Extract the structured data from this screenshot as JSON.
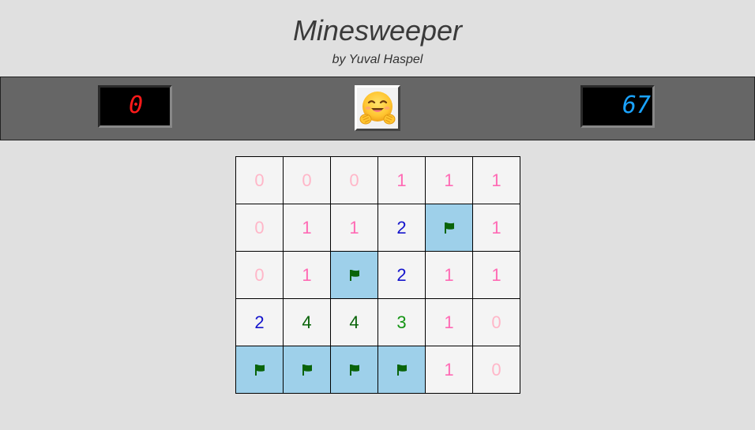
{
  "header": {
    "title": "Minesweeper",
    "subtitle": "by Yuval Haspel"
  },
  "controls": {
    "mines_counter": "0",
    "timer": "67",
    "face_icon": "hugging-face-emoji",
    "mines_color": "#ff1a1a",
    "timer_color": "#1aa3ff"
  },
  "board": {
    "rows": 5,
    "cols": 6,
    "flag_color": "#0a640a",
    "flagged_bg": "#9ed0ea",
    "cells": [
      [
        "0",
        "0",
        "0",
        "1",
        "1",
        "1"
      ],
      [
        "0",
        "1",
        "1",
        "2",
        "F",
        "1"
      ],
      [
        "0",
        "1",
        "F",
        "2",
        "1",
        "1"
      ],
      [
        "2",
        "4",
        "4",
        "3",
        "1",
        "0"
      ],
      [
        "F",
        "F",
        "F",
        "F",
        "1",
        "0"
      ]
    ]
  }
}
